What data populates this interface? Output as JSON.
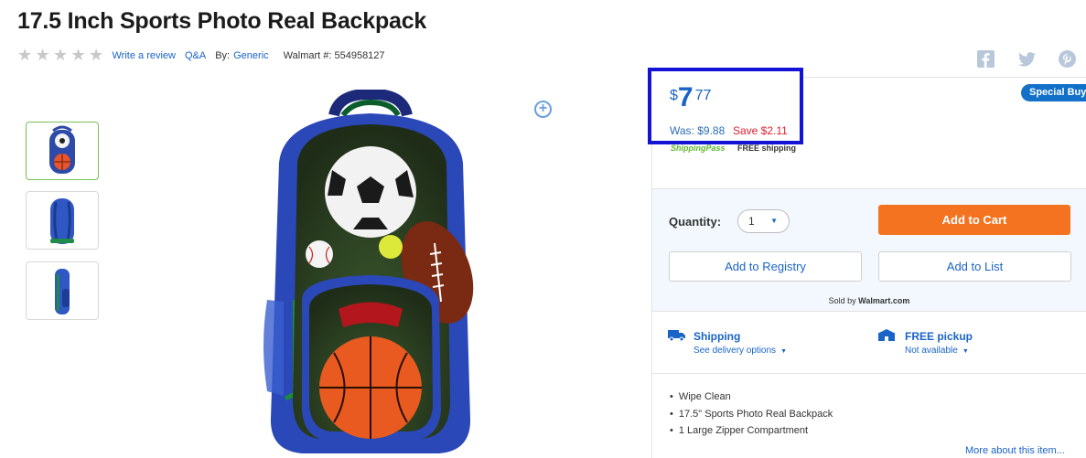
{
  "product": {
    "title": "17.5 Inch Sports Photo Real Backpack",
    "rating_stars": 0,
    "write_review": "Write a review",
    "qa": "Q&A",
    "by_label": "By:",
    "brand": "Generic",
    "walmart_number": "Walmart #: 554958127"
  },
  "social": {
    "icons": [
      "facebook-icon",
      "twitter-icon",
      "pinterest-icon"
    ]
  },
  "gallery": {
    "thumbnails": [
      "backpack-front",
      "backpack-back",
      "backpack-side"
    ],
    "active_index": 0
  },
  "price": {
    "currency": "$",
    "dollars": "7",
    "cents": "77",
    "was": "Was: $9.88",
    "save": "Save $2.11"
  },
  "badge": "Special Buy",
  "shipping_pass": {
    "logo": "ShippingPass",
    "text": "FREE shipping"
  },
  "cart": {
    "quantity_label": "Quantity:",
    "quantity_value": "1",
    "add_to_cart": "Add to Cart",
    "add_to_registry": "Add to Registry",
    "add_to_list": "Add to List",
    "sold_by_label": "Sold by",
    "sold_by_value": "Walmart.com"
  },
  "fulfillment": {
    "shipping_title": "Shipping",
    "shipping_sub": "See delivery options",
    "pickup_title": "FREE pickup",
    "pickup_sub": "Not available"
  },
  "features": [
    "Wipe Clean",
    "17.5\" Sports Photo Real Backpack",
    "1 Large Zipper Compartment"
  ],
  "more_about": "More about this item..."
}
